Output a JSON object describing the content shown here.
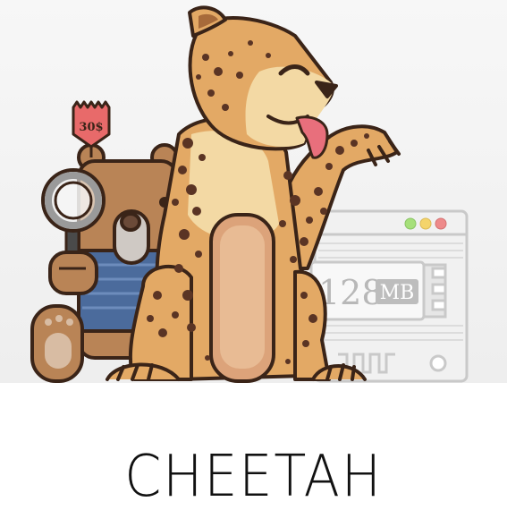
{
  "illustration": {
    "price_tag": "30$",
    "memory_label_value": "128",
    "memory_label_unit": "MB"
  },
  "title": "CHEETAH",
  "colors": {
    "cheetah_fur": "#e3a965",
    "cheetah_light": "#f3d9a4",
    "cheetah_spot": "#5a3424",
    "bear_fur": "#b98456",
    "bear_shirt": "#4b6b9c",
    "tag": "#e86a6a",
    "outline": "#3a2418",
    "device_gray": "#d7d7d7"
  }
}
